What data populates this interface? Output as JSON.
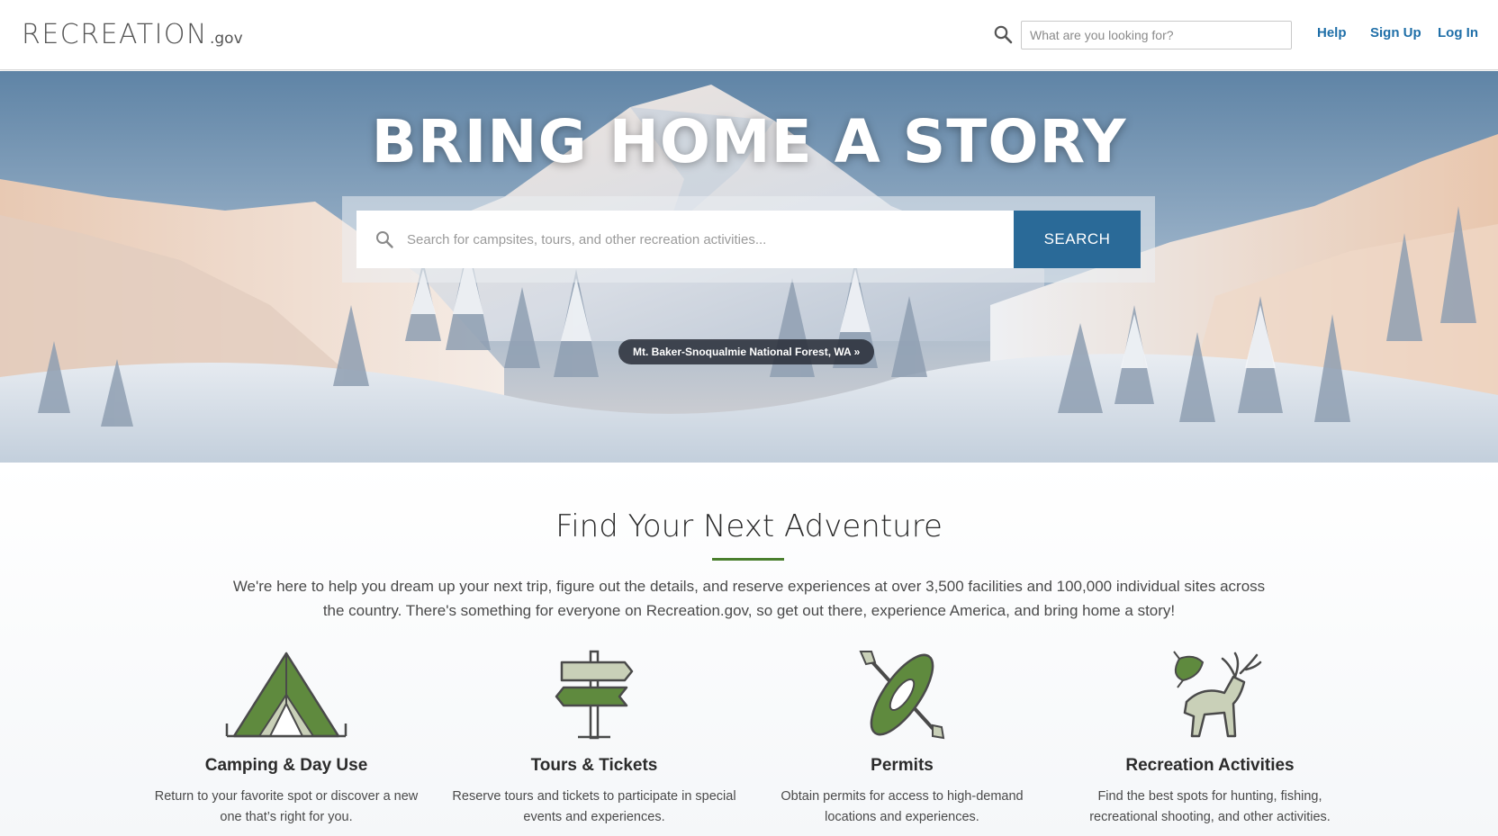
{
  "header": {
    "logo_main": "RECREATION",
    "logo_suffix": ".gov",
    "search_placeholder": "What are you looking for?",
    "nav": [
      "Help",
      "Sign Up",
      "Log In"
    ]
  },
  "hero": {
    "title": "BRING HOME A STORY",
    "search_placeholder": "Search for campsites, tours, and other recreation activities...",
    "search_button": "SEARCH",
    "location_link": "Mt. Baker-Snoqualmie National Forest, WA »"
  },
  "adventure": {
    "title": "Find Your Next Adventure",
    "intro": "We're here to help you dream up your next trip, figure out the details, and reserve experiences at over 3,500 facilities and 100,000 individual sites across the country. There's something for everyone on Recreation.gov, so get out there, experience America, and bring home a story!",
    "cards": [
      {
        "icon": "tent-icon",
        "title": "Camping & Day Use",
        "desc": "Return to your favorite spot or discover a new one that’s right for you."
      },
      {
        "icon": "signpost-icon",
        "title": "Tours & Tickets",
        "desc": "Reserve tours and tickets to participate in special events and experiences."
      },
      {
        "icon": "kayak-icon",
        "title": "Permits",
        "desc": "Obtain permits for access to high-demand locations and experiences."
      },
      {
        "icon": "deer-fish-icon",
        "title": "Recreation Activities",
        "desc": "Find the best spots for hunting, fishing, recreational shooting, and other activities."
      }
    ]
  },
  "colors": {
    "brand_green": "#4a7f2e",
    "link_blue": "#1f6fa8",
    "button_blue": "#2a6a98"
  }
}
